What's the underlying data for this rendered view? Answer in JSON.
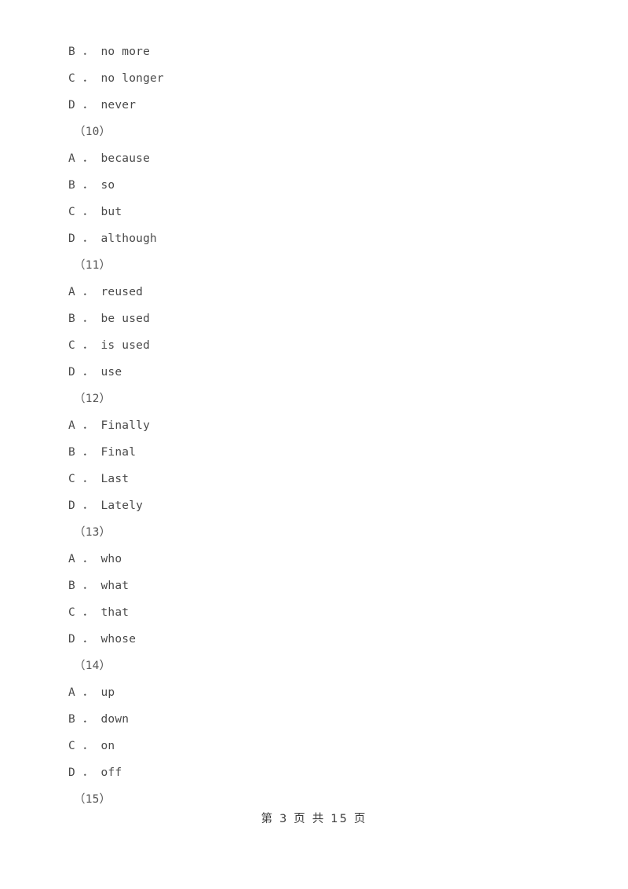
{
  "document": {
    "page_background": "#ffffff",
    "text_color": "#4a4a4a",
    "lines": [
      {
        "kind": "option",
        "text": "B ． no more"
      },
      {
        "kind": "option",
        "text": "C ． no longer"
      },
      {
        "kind": "option",
        "text": "D ． never"
      },
      {
        "kind": "qnum",
        "text": "（10）"
      },
      {
        "kind": "option",
        "text": "A ． because"
      },
      {
        "kind": "option",
        "text": "B ． so"
      },
      {
        "kind": "option",
        "text": "C ． but"
      },
      {
        "kind": "option",
        "text": "D ． although"
      },
      {
        "kind": "qnum",
        "text": "（11）"
      },
      {
        "kind": "option",
        "text": "A ． reused"
      },
      {
        "kind": "option",
        "text": "B ． be used"
      },
      {
        "kind": "option",
        "text": "C ． is used"
      },
      {
        "kind": "option",
        "text": "D ． use"
      },
      {
        "kind": "qnum",
        "text": "（12）"
      },
      {
        "kind": "option",
        "text": "A ． Finally"
      },
      {
        "kind": "option",
        "text": "B ． Final"
      },
      {
        "kind": "option",
        "text": "C ． Last"
      },
      {
        "kind": "option",
        "text": "D ． Lately"
      },
      {
        "kind": "qnum",
        "text": "（13）"
      },
      {
        "kind": "option",
        "text": "A ． who"
      },
      {
        "kind": "option",
        "text": "B ． what"
      },
      {
        "kind": "option",
        "text": "C ． that"
      },
      {
        "kind": "option",
        "text": "D ． whose"
      },
      {
        "kind": "qnum",
        "text": "（14）"
      },
      {
        "kind": "option",
        "text": "A ． up"
      },
      {
        "kind": "option",
        "text": "B ． down"
      },
      {
        "kind": "option",
        "text": "C ． on"
      },
      {
        "kind": "option",
        "text": "D ． off"
      },
      {
        "kind": "qnum",
        "text": "（15）"
      }
    ]
  },
  "footer": {
    "page_label": "第 3 页 共 15 页",
    "current_page": "3",
    "total_pages": "15"
  }
}
